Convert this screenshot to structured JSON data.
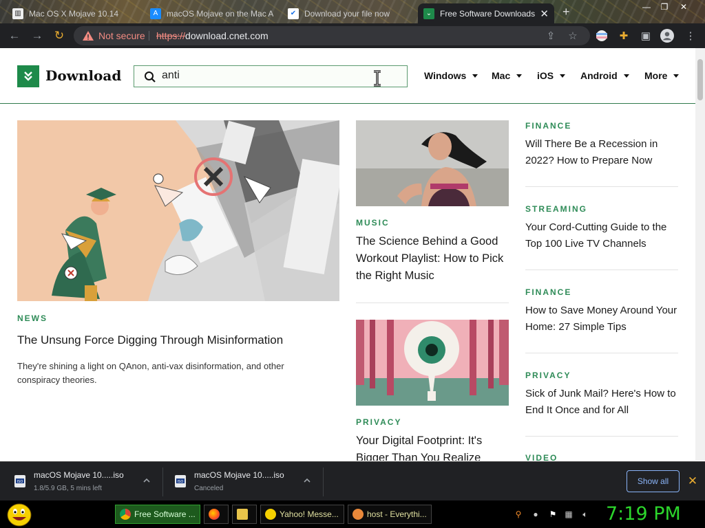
{
  "browser": {
    "tabs": [
      {
        "title": "Mac OS X Mojave 10.14",
        "favicon": "building-icon",
        "active": false
      },
      {
        "title": "macOS Mojave on the Mac App Store",
        "favicon": "app-store-icon",
        "active": false
      },
      {
        "title": "Download your file now",
        "favicon": "checkmark-shield-icon",
        "active": false
      },
      {
        "title": "Free Software Downloads",
        "favicon": "download-logo-icon",
        "active": true
      }
    ],
    "security_label": "Not secure",
    "url_scheme": "https://",
    "url_host": "download.cnet.com"
  },
  "site": {
    "logo_text": "Download",
    "search_value": "anti",
    "nav": [
      "Windows",
      "Mac",
      "iOS",
      "Android",
      "More"
    ],
    "brand_color": "#1e8a4a"
  },
  "main_feature": {
    "category": "NEWS",
    "headline": "The Unsung Force Digging Through Misinformation",
    "description": "They're shining a light on QAnon, anti-vax disinformation, and other conspiracy theories."
  },
  "middle_articles": [
    {
      "category": "MUSIC",
      "headline": "The Science Behind a Good Workout Playlist: How to Pick the Right Music"
    },
    {
      "category": "PRIVACY",
      "headline": "Your Digital Footprint: It's Bigger Than You Realize"
    }
  ],
  "side_articles": [
    {
      "category": "FINANCE",
      "headline": "Will There Be a Recession in 2022? How to Prepare Now"
    },
    {
      "category": "STREAMING",
      "headline": "Your Cord-Cutting Guide to the Top 100 Live TV Channels"
    },
    {
      "category": "FINANCE",
      "headline": "How to Save Money Around Your Home: 27 Simple Tips"
    },
    {
      "category": "PRIVACY",
      "headline": "Sick of Junk Mail? Here's How to End It Once and for All"
    },
    {
      "category": "VIDEO",
      "headline": ""
    }
  ],
  "downloads": [
    {
      "name": "macOS Mojave 10.....iso",
      "status": "1.8/5.9 GB, 5 mins left"
    },
    {
      "name": "macOS Mojave 10.....iso",
      "status": "Canceled"
    }
  ],
  "downloads_show_all": "Show all",
  "taskbar": {
    "tasks": [
      {
        "label": "Free Software ...",
        "icon": "chrome-icon",
        "active": true
      },
      {
        "label": "",
        "icon": "firefox-icon",
        "active": false
      },
      {
        "label": "",
        "icon": "folder-icon",
        "active": false
      },
      {
        "label": "Yahoo! Messe...",
        "icon": "yahoo-messenger-icon",
        "active": false
      },
      {
        "label": "host - Everythi...",
        "icon": "everything-search-icon",
        "active": false
      }
    ],
    "clock": "7:19 PM"
  }
}
